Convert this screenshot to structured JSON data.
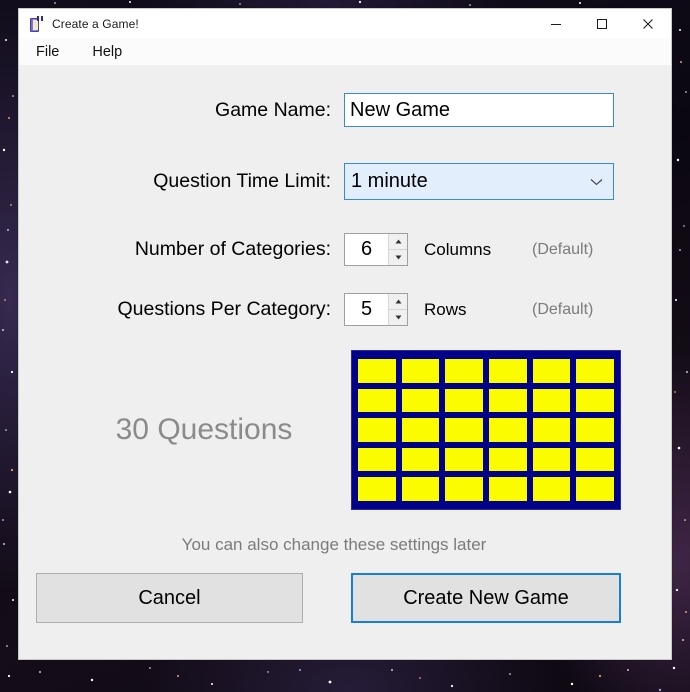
{
  "window": {
    "title": "Create a Game!",
    "icon": "app-window-icon",
    "controls": {
      "minimize": "minimize-icon",
      "maximize": "maximize-icon",
      "close": "close-icon"
    }
  },
  "menubar": {
    "items": [
      {
        "label": "File"
      },
      {
        "label": "Help"
      }
    ]
  },
  "form": {
    "game_name": {
      "label": "Game Name:",
      "value": "New Game",
      "placeholder": "New Game"
    },
    "time_limit": {
      "label": "Question Time Limit:",
      "value": "1 minute",
      "options": [
        "1 minute"
      ],
      "chevron": "chevron-down-icon"
    },
    "categories": {
      "label": "Number of Categories:",
      "value": "6",
      "unit": "Columns",
      "note": "(Default)"
    },
    "questions_per_category": {
      "label": "Questions Per Category:",
      "value": "5",
      "unit": "Rows",
      "note": "(Default)"
    }
  },
  "board_preview": {
    "columns": 6,
    "rows": 5,
    "board_color": "#020288",
    "tile_color": "#fcfc00"
  },
  "summary": {
    "questions_count": "30 Questions"
  },
  "hint": {
    "text": "You can also change these settings later"
  },
  "footer": {
    "cancel_label": "Cancel",
    "create_label": "Create New Game"
  },
  "colors": {
    "accent_blue": "#1a7fd4",
    "field_border": "#3a8ad2",
    "combo_fill": "#e2eefb",
    "window_bg": "#efefef",
    "muted_text": "#7b7b7b"
  }
}
